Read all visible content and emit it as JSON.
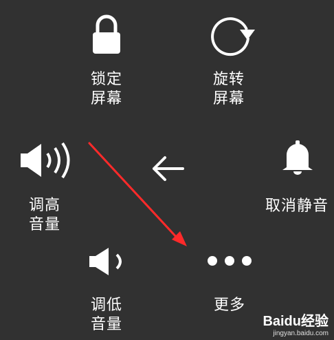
{
  "menu": {
    "lock": {
      "line1": "锁定",
      "line2": "屏幕",
      "icon": "lock-icon"
    },
    "rotate": {
      "line1": "旋转",
      "line2": "屏幕",
      "icon": "rotate-icon"
    },
    "volume_up": {
      "line1": "调高",
      "line2": "音量",
      "icon": "volume-up-icon"
    },
    "back": {
      "icon": "back-arrow-icon"
    },
    "mute": {
      "label": "取消静音",
      "icon": "bell-icon"
    },
    "volume_down": {
      "line1": "调低",
      "line2": "音量",
      "icon": "volume-down-icon"
    },
    "more": {
      "label": "更多",
      "icon": "more-dots-icon"
    }
  },
  "annotation": {
    "color": "#ff2a2a"
  },
  "watermark": {
    "logo": "Baidu经验",
    "url": "jingyan.baidu.com"
  },
  "colors": {
    "background": "#313131",
    "foreground": "#ffffff"
  }
}
